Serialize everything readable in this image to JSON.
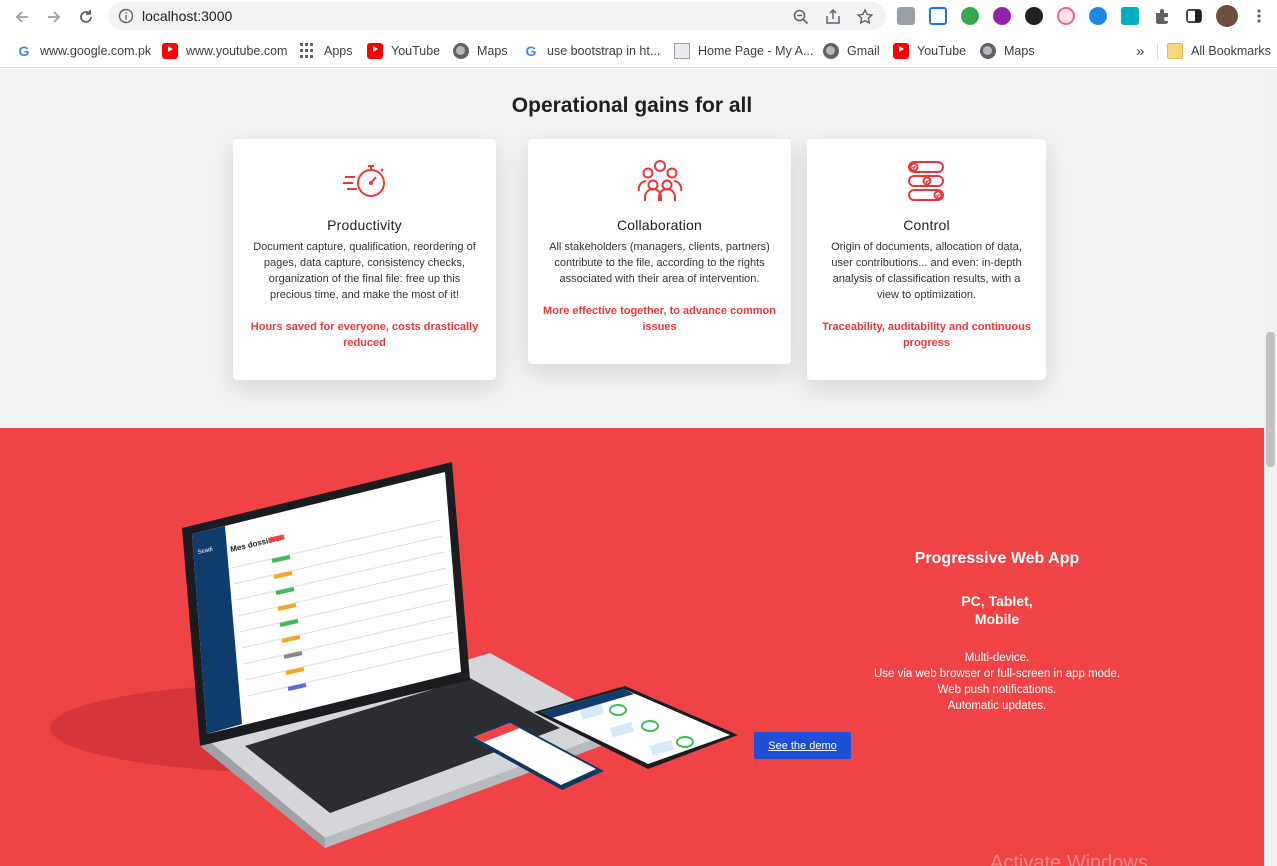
{
  "browser": {
    "url": "localhost:3000",
    "bookmarks": [
      {
        "label": "www.google.com.pk",
        "icon": "google-icon"
      },
      {
        "label": "www.youtube.com",
        "icon": "youtube-icon"
      },
      {
        "label": "Apps",
        "icon": "apps-grid-icon"
      },
      {
        "label": "YouTube",
        "icon": "youtube-icon"
      },
      {
        "label": "Maps",
        "icon": "globe-icon"
      },
      {
        "label": "use bootstrap in ht...",
        "icon": "google-icon"
      },
      {
        "label": "Home Page - My A...",
        "icon": "document-icon"
      },
      {
        "label": "Gmail",
        "icon": "globe-icon"
      },
      {
        "label": "YouTube",
        "icon": "youtube-icon"
      },
      {
        "label": "Maps",
        "icon": "globe-icon"
      }
    ],
    "more_bookmarks": "»",
    "all_bookmarks": "All Bookmarks"
  },
  "gains": {
    "title": "Operational gains for all",
    "cards": [
      {
        "icon": "stopwatch-icon",
        "title": "Productivity",
        "text": "Document capture, qualification, reordering of pages, data capture, consistency checks, organization of the final file: free up this precious time, and make the most of it!",
        "highlight": "Hours saved for everyone, costs drastically reduced"
      },
      {
        "icon": "team-icon",
        "title": "Collaboration",
        "text": "All stakeholders (managers, clients, partners) contribute to the file, according to the rights associated with their area of intervention.",
        "highlight": "More effective together, to advance common issues"
      },
      {
        "icon": "checklist-flow-icon",
        "title": "Control",
        "text": "Origin of documents, allocation of data, user contributions... and even: in-depth analysis of classification results, with a view to optimization.",
        "highlight": "Traceability, auditability and continuous progress"
      }
    ]
  },
  "pwa": {
    "title": "Progressive Web App",
    "devices_line1": "PC, Tablet,",
    "devices_line2": "Mobile",
    "feature1": "Multi-device.",
    "feature2": "Use via web browser or full-screen in app mode.",
    "feature3": "Web push notifications.",
    "feature4": "Automatic updates.",
    "demo_button": "See the demo",
    "mockup_heading": "Mes dossiers",
    "mockup_brand": "Seadi",
    "watermark": "Activate Windows"
  },
  "colors": {
    "accent_red": "#ef4346",
    "highlight_red": "#e8373c",
    "button_blue": "#1d4fd8",
    "section_gray": "#f1f2f4"
  }
}
